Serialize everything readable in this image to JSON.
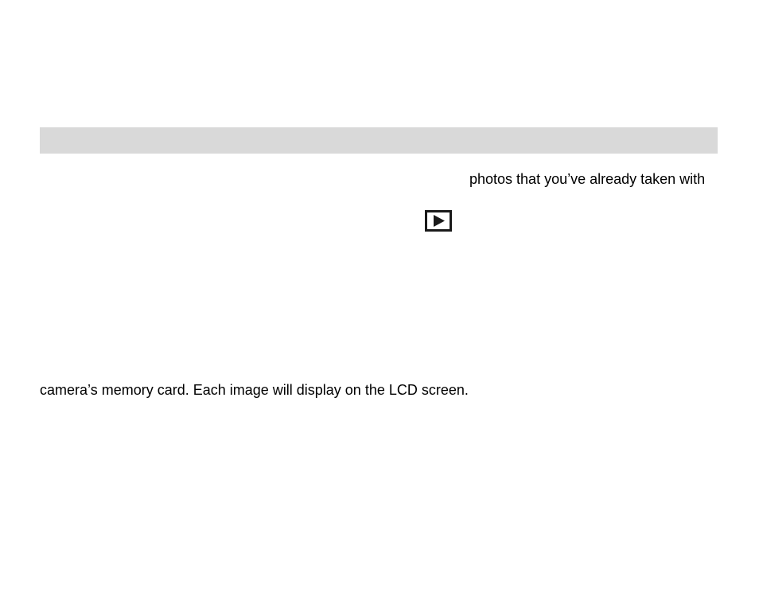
{
  "bar": {},
  "text": {
    "line1": "photos that you’ve already taken with",
    "line2": "camera’s memory card. Each image will display on the LCD screen."
  }
}
